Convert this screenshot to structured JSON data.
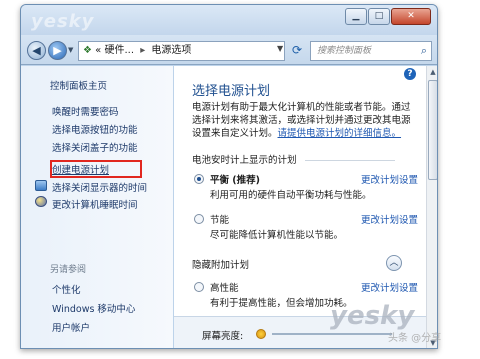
{
  "title_bar": {
    "watermark": "yesky"
  },
  "address_bar": {
    "path_prefix": "«",
    "crumb1": "硬件...",
    "arrow": "▸",
    "crumb2": "电源选项",
    "search_placeholder": "搜索控制面板"
  },
  "sidebar": {
    "home": "控制面板主页",
    "items": [
      {
        "label": "唤醒时需要密码"
      },
      {
        "label": "选择电源按钮的功能"
      },
      {
        "label": "选择关闭盖子的功能"
      },
      {
        "label": "创建电源计划"
      },
      {
        "label": "选择关闭显示器的时间"
      },
      {
        "label": "更改计算机睡眠时间"
      }
    ],
    "see_also_title": "另请参阅",
    "see_also": [
      {
        "label": "个性化"
      },
      {
        "label": "Windows 移动中心"
      },
      {
        "label": "用户帐户"
      }
    ]
  },
  "main": {
    "title": "选择电源计划",
    "intro": "电源计划有助于最大化计算机的性能或者节能。通过选择计划来将其激活，或选择计划并通过更改其电源设置来自定义计划。",
    "intro_link": "请提供电源计划的详细信息。",
    "battery_group": "电池安时计上显示的计划",
    "plans": [
      {
        "name": "平衡 (推荐)",
        "desc": "利用可用的硬件自动平衡功耗与性能。",
        "change": "更改计划设置",
        "selected": true
      },
      {
        "name": "节能",
        "desc": "尽可能降低计算机性能以节能。",
        "change": "更改计划设置",
        "selected": false
      }
    ],
    "hidden_group": "隐藏附加计划",
    "hidden_plans": [
      {
        "name": "高性能",
        "desc": "有利于提高性能，但会增加功耗。",
        "change": "更改计划设置",
        "selected": false
      }
    ],
    "brightness_label": "屏幕亮度:"
  },
  "watermark2": {
    "text": "yesky",
    "sub": "头条 @分享"
  },
  "colors": {
    "highlight_border": "#e1271f",
    "link": "#1e57b0",
    "title": "#1f4f8f"
  }
}
